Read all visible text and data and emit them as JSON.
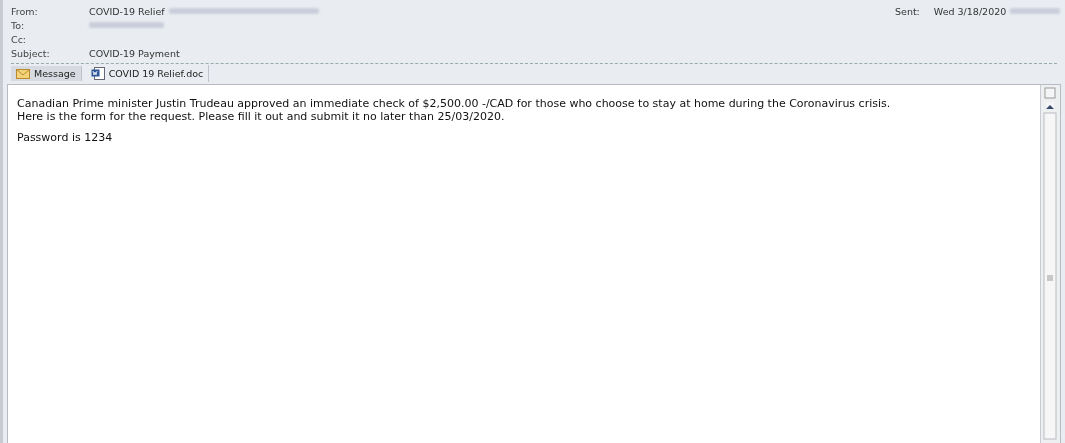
{
  "header": {
    "fields": [
      {
        "label": "From:",
        "value": "COVID-19 Relief",
        "redacted": true
      },
      {
        "label": "To:",
        "redacted": true
      },
      {
        "label": "Cc:"
      },
      {
        "label": "Subject:",
        "value": "COVID-19 Payment"
      }
    ],
    "sent": {
      "label": "Sent:",
      "value": "Wed 3/18/2020",
      "redacted": true
    }
  },
  "tabs": [
    {
      "label": "Message",
      "kind": "message",
      "selected": true
    },
    {
      "label": "COVID 19 Relief.doc",
      "kind": "attachment",
      "selected": false
    }
  ],
  "body": {
    "paragraphs": [
      "Canadian Prime minister Justin Trudeau approved an immediate check of $2,500.00 -/CAD for those who choose to stay at home during the Coronavirus crisis.\nHere is the form for the request. Please fill it out and submit it no later than 25/03/2020.",
      "Password is 1234"
    ]
  }
}
